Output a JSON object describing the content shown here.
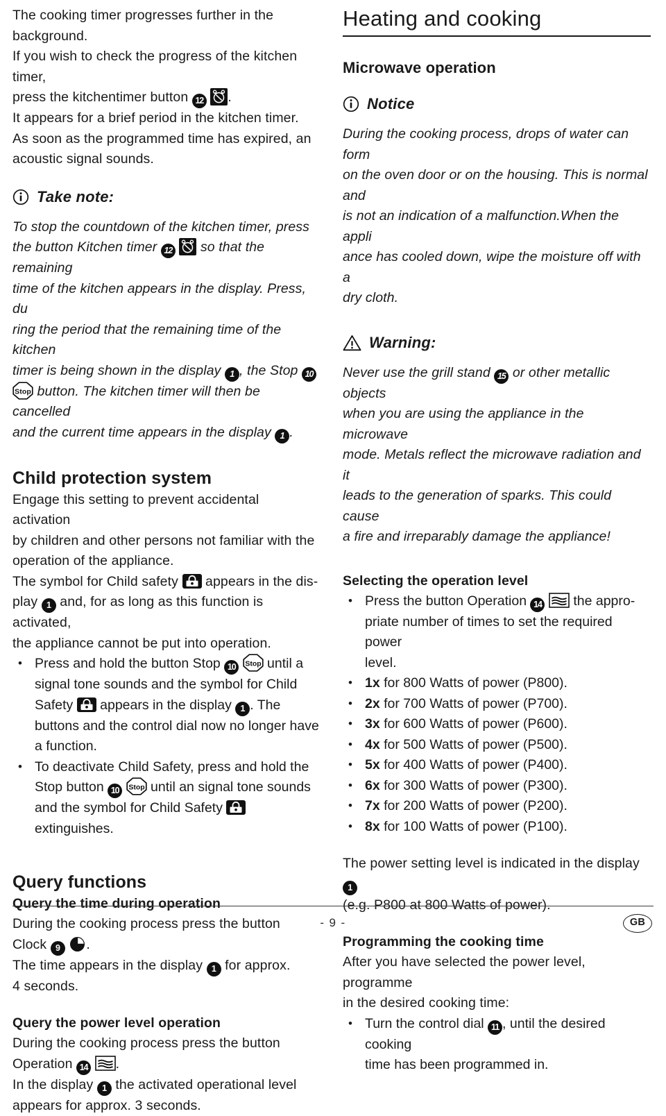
{
  "footer": {
    "page_number": "- 9 -",
    "language_badge": "GB"
  },
  "left_column": {
    "intro_paragraph": {
      "l1": "The cooking timer progresses further in the background.",
      "l2": "If you wish to check the progress of the kitchen timer,",
      "l3a": "press the kitchentimer button",
      "l3_badge": "12",
      "l3_icon": "alarm-clock-icon",
      "l3b": ".",
      "l4": "It appears for a brief period in the kitchen timer.",
      "l5": "As soon as the programmed time has expired, an",
      "l6": "acoustic signal sounds."
    },
    "take_note": {
      "icon": "info-icon",
      "title": "Take note:",
      "t1": "To stop the countdown of  the kitchen timer, press",
      "t2a": "the button Kitchen timer",
      "t2_badge": "12",
      "t2_icon": "alarm-clock-icon",
      "t2b": "so that the remaining",
      "t3": "time of the kitchen appears in the display. Press, du",
      "t4": "ring the period that the remaining time of the kitchen",
      "t5a": "timer is being shown in the display",
      "t5_badge1": "1",
      "t5b": ", the Stop",
      "t5_badge2": "10",
      "t6_icon": "stop-icon",
      "t6": "button. The kitchen timer will then be cancelled",
      "t7a": "and the current time appears in the display",
      "t7_badge": "1",
      "t7b": "."
    },
    "child_protection": {
      "heading": "Child protection system",
      "p1_l1": "Engage this setting to prevent accidental activation",
      "p1_l2": "by children and other persons not familiar with the",
      "p1_l3": "operation of the appliance.",
      "p2_l1a": "The symbol for Child safety",
      "p2_l1_icon": "child-lock-icon",
      "p2_l1b": "appears in the dis-",
      "p2_l2a": "play",
      "p2_l2_badge": "1",
      "p2_l2b": "and, for as long as this function is activated,",
      "p2_l3": "the appliance cannot be put into operation.",
      "bullet1": {
        "l1a": "Press and hold the button Stop",
        "l1_badge": "10",
        "l1_icon": "stop-icon",
        "l1b": "until a",
        "l2": "signal tone sounds and the symbol for Child",
        "l3a": "Safety",
        "l3_icon": "child-lock-icon",
        "l3b": "appears in the display",
        "l3_badge": "1",
        "l3c": ". The",
        "l4": "buttons and the control dial now no longer have",
        "l5": "a function."
      },
      "bullet2": {
        "l1": "To deactivate Child Safety, press and hold the",
        "l2a": "Stop button",
        "l2_badge": "10",
        "l2_icon": "stop-icon",
        "l2b": "until an signal tone sounds",
        "l3a": "and the symbol for Child Safety",
        "l3_icon": "child-lock-icon",
        "l3b": "extinguishes."
      }
    },
    "query_functions": {
      "heading": "Query functions",
      "sub1": {
        "heading": "Query the time during operation",
        "l1": "During the cooking process press the button",
        "l2a": "Clock",
        "l2_badge": "9",
        "l2_icon": "clock-icon",
        "l2b": ".",
        "l3a": "The time appears in the display",
        "l3_badge": "1",
        "l3b": "for approx.",
        "l4": "4 seconds."
      },
      "sub2": {
        "heading": "Query the power level operation",
        "l1": "During the cooking process press the button",
        "l2a": "Operation",
        "l2_badge": "14",
        "l2_icon": "microwave-wave-icon",
        "l2b": ".",
        "l3a": "In the display",
        "l3_badge": "1",
        "l3b": "the activated operational level",
        "l4": "appears for approx. 3 seconds."
      }
    }
  },
  "right_column": {
    "title": "Heating and cooking",
    "microwave_operation": {
      "heading": "Microwave operation",
      "notice": {
        "icon": "info-icon",
        "title": "Notice",
        "l1": "During the cooking process, drops of water can form",
        "l2": "on the oven door or on the housing. This is normal and",
        "l3": "is not an indication of a malfunction.When the appli",
        "l4": "ance has cooled down, wipe the moisture off with a",
        "l5": "dry cloth."
      },
      "warning": {
        "icon": "warning-icon",
        "title": "Warning:",
        "l1a": "Never use the grill stand",
        "l1_badge": "15",
        "l1b": "or other metallic objects",
        "l2": "when you are using the appliance in the microwave",
        "l3": "mode. Metals reflect the microwave radiation and it",
        "l4": "leads to the generation of sparks. This could cause",
        "l5": "a fire and irreparably damage the appliance!"
      }
    },
    "selecting_operation_level": {
      "heading": "Selecting the operation level",
      "first_bullet": {
        "l1a": "Press the button Operation",
        "l1_badge": "14",
        "l1_icon": "microwave-wave-icon",
        "l1b": "the appro-",
        "l2": "priate number of times to set the required power",
        "l3": "level."
      },
      "power_levels": [
        {
          "times": "1x",
          "text": "for 800 Watts of power (P800)."
        },
        {
          "times": "2x",
          "text": "for 700 Watts of power (P700)."
        },
        {
          "times": "3x",
          "text": "for 600 Watts of power (P600)."
        },
        {
          "times": "4x",
          "text": "for 500 Watts of power (P500)."
        },
        {
          "times": "5x",
          "text": "for 400 Watts of power (P400)."
        },
        {
          "times": "6x",
          "text": "for 300 Watts of power (P300)."
        },
        {
          "times": "7x",
          "text": "for 200 Watts of power (P200)."
        },
        {
          "times": "8x",
          "text": "for 100 Watts of power (P100)."
        }
      ],
      "after_list": {
        "l1a": "The power setting level is indicated in the display",
        "l1_badge": "1",
        "l2": "(e.g. P800 at 800 Watts of power)."
      }
    },
    "programming_cooking_time": {
      "heading": "Programming the cooking time",
      "l1": "After you have selected the power level, programme",
      "l2": "in the desired cooking time:",
      "bullet": {
        "l1a": "Turn the control dial",
        "l1_badge": "11",
        "l1b": ", until the desired cooking",
        "l2": "time has been programmed in."
      }
    }
  }
}
